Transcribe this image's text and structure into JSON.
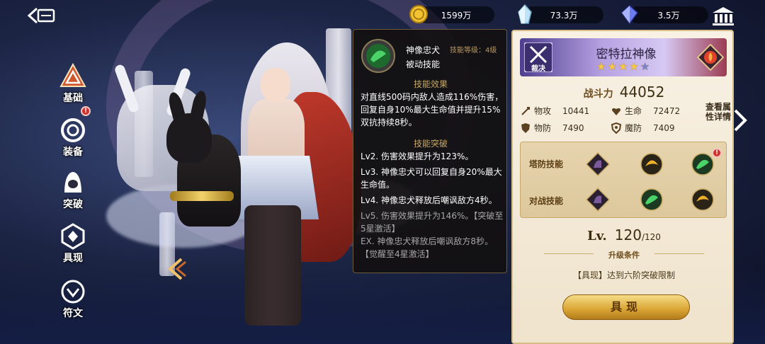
{
  "resources": {
    "gold": "1599万",
    "crystal": "73.3万",
    "gem": "3.5万"
  },
  "left_menu": [
    {
      "label": "基础",
      "icon": "triangle-emblem-icon",
      "active": true
    },
    {
      "label": "装备",
      "icon": "ring-icon"
    },
    {
      "label": "突破",
      "icon": "hood-icon"
    },
    {
      "label": "具现",
      "icon": "crest-icon"
    },
    {
      "label": "符文",
      "icon": "rune-icon"
    }
  ],
  "tooltip": {
    "skill_name": "神像忠犬",
    "skill_level": "技能等级：4级",
    "skill_type": "被动技能",
    "effect_title": "技能效果",
    "effect_text": "对直线500码内敌人造成116%伤害，回复自身10%最大生命值并提升15%双抗持续8秒。",
    "break_title": "技能突破",
    "breaks": [
      "Lv2. 伤害效果提升为123%。",
      "Lv3. 神像忠犬可以回复自身20%最大生命值。",
      "Lv4. 神像忠犬释放后嘲讽敌方4秒。",
      "Lv5. 伤害效果提升为146%。【突破至5星激活】",
      "EX. 神像忠犬释放后嘲讽敌方8秒。【觉醒至4星激活】"
    ]
  },
  "hero": {
    "name": "密特拉神像",
    "class_label": "裁决",
    "stars_filled": 4,
    "stars_total": 5,
    "power_label": "战斗力",
    "power": "44052",
    "stats": {
      "atk_label": "物攻",
      "atk": "10441",
      "hp_label": "生命",
      "hp": "72472",
      "def_label": "物防",
      "def": "7490",
      "mdef_label": "魔防",
      "mdef": "7409"
    },
    "more_attr": "查看属性详情",
    "tower_skill_label": "塔防技能",
    "battle_skill_label": "对战技能",
    "lv_label": "Lv.",
    "level": "120",
    "level_max": "/120",
    "upgrade_title": "升级条件",
    "upgrade_desc": "【具现】达到六阶突破限制",
    "main_button": "具现"
  },
  "colors": {
    "accent_gold": "#d9a433",
    "panel_bg": "#f8f1e4",
    "tooltip_bg": "#121010",
    "section_gold": "#c9a962"
  }
}
